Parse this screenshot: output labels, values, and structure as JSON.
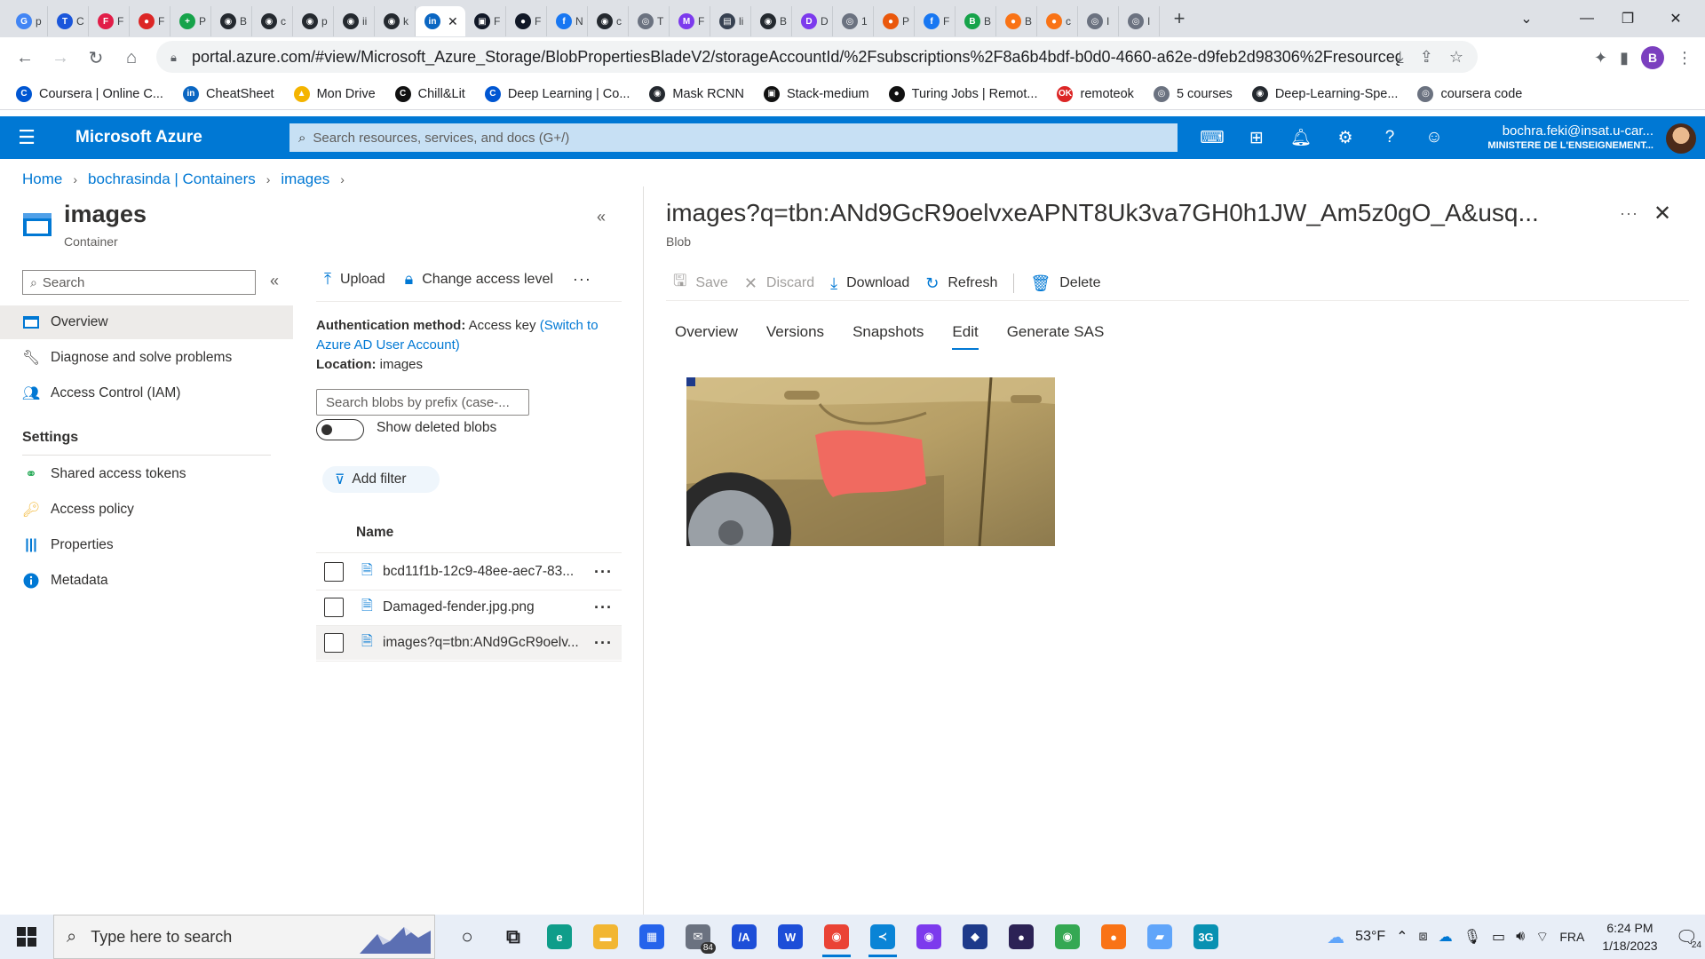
{
  "browser": {
    "tabs": [
      {
        "letter": "G",
        "label": "p",
        "color": "#4285f4"
      },
      {
        "letter": "T",
        "label": "C",
        "color": "#1a56db"
      },
      {
        "letter": "F",
        "label": "F",
        "color": "#e11d48"
      },
      {
        "letter": "●",
        "label": "F",
        "color": "#dc2626"
      },
      {
        "letter": "+",
        "label": "P",
        "color": "#16a34a"
      },
      {
        "letter": "◉",
        "label": "B",
        "color": "#24292f"
      },
      {
        "letter": "◉",
        "label": "c",
        "color": "#24292f"
      },
      {
        "letter": "◉",
        "label": "p",
        "color": "#24292f"
      },
      {
        "letter": "◉",
        "label": "ii",
        "color": "#24292f"
      },
      {
        "letter": "◉",
        "label": "k",
        "color": "#24292f"
      },
      {
        "letter": "in",
        "label": "",
        "color": "#0a66c2"
      },
      {
        "letter": "▣",
        "label": "F",
        "color": "#111827"
      },
      {
        "letter": "●",
        "label": "F",
        "color": "#111827"
      },
      {
        "letter": "f",
        "label": "N",
        "color": "#1877f2"
      },
      {
        "letter": "◉",
        "label": "c",
        "color": "#24292f"
      },
      {
        "letter": "◎",
        "label": "T",
        "color": "#6b7280"
      },
      {
        "letter": "M",
        "label": "F",
        "color": "#7c3aed"
      },
      {
        "letter": "▤",
        "label": "li",
        "color": "#374151"
      },
      {
        "letter": "◉",
        "label": "B",
        "color": "#24292f"
      },
      {
        "letter": "D",
        "label": "D",
        "color": "#7c3aed"
      },
      {
        "letter": "◎",
        "label": "1",
        "color": "#6b7280"
      },
      {
        "letter": "●",
        "label": "P",
        "color": "#ea580c"
      },
      {
        "letter": "f",
        "label": "F",
        "color": "#1877f2"
      },
      {
        "letter": "B",
        "label": "B",
        "color": "#16a34a"
      },
      {
        "letter": "●",
        "label": "B",
        "color": "#f97316"
      },
      {
        "letter": "●",
        "label": "c",
        "color": "#f97316"
      },
      {
        "letter": "◎",
        "label": "I",
        "color": "#6b7280"
      },
      {
        "letter": "◎",
        "label": "I",
        "color": "#6b7280"
      }
    ],
    "active_tab_index": 10,
    "url": "portal.azure.com/#view/Microsoft_Azure_Storage/BlobPropertiesBladeV2/storageAccountId/%2Fsubscriptions%2F8a6b4bdf-b0d0-4660-a62e-d9feb2d98306%2Fresourcegroups%2...",
    "profile_initial": "B",
    "bookmarks": [
      {
        "label": "Coursera | Online C...",
        "icon": "coursera-icon",
        "color": "#0056d2",
        "glyph": "C"
      },
      {
        "label": "CheatSheet",
        "icon": "linkedin-icon",
        "color": "#0a66c2",
        "glyph": "in"
      },
      {
        "label": "Mon Drive",
        "icon": "drive-icon",
        "color": "#f4b400",
        "glyph": "▲"
      },
      {
        "label": "Chill&Lit",
        "icon": "cgl-icon",
        "color": "#111111",
        "glyph": "C"
      },
      {
        "label": "Deep Learning | Co...",
        "icon": "coursera-icon",
        "color": "#0056d2",
        "glyph": "C"
      },
      {
        "label": "Mask RCNN",
        "icon": "github-icon",
        "color": "#24292f",
        "glyph": "◉"
      },
      {
        "label": "Stack-medium",
        "icon": "medium-icon",
        "color": "#111111",
        "glyph": "▣"
      },
      {
        "label": "Turing Jobs | Remot...",
        "icon": "turing-icon",
        "color": "#111111",
        "glyph": "●"
      },
      {
        "label": "remoteok",
        "icon": "remoteok-icon",
        "color": "#dc2626",
        "glyph": "OK"
      },
      {
        "label": "5 courses",
        "icon": "globe-icon",
        "color": "#6b7280",
        "glyph": "◎"
      },
      {
        "label": "Deep-Learning-Spe...",
        "icon": "github-icon",
        "color": "#24292f",
        "glyph": "◉"
      },
      {
        "label": "coursera code",
        "icon": "globe-icon",
        "color": "#6b7280",
        "glyph": "◎"
      }
    ]
  },
  "azure": {
    "brand": "Microsoft Azure",
    "search_placeholder": "Search resources, services, and docs (G+/)",
    "user_email": "bochra.feki@insat.u-car...",
    "user_org": "MINISTERE DE L'ENSEIGNEMENT...",
    "breadcrumb": [
      "Home",
      "bochrasinda | Containers",
      "images"
    ]
  },
  "left": {
    "title": "images",
    "subtitle": "Container",
    "search_placeholder": "Search",
    "nav": [
      {
        "label": "Overview",
        "icon": "overview-icon"
      },
      {
        "label": "Diagnose and solve problems",
        "icon": "wrench-icon"
      },
      {
        "label": "Access Control (IAM)",
        "icon": "people-icon"
      }
    ],
    "settings_heading": "Settings",
    "settings": [
      {
        "label": "Shared access tokens",
        "icon": "link-icon"
      },
      {
        "label": "Access policy",
        "icon": "key-icon"
      },
      {
        "label": "Properties",
        "icon": "properties-icon"
      },
      {
        "label": "Metadata",
        "icon": "info-icon"
      }
    ]
  },
  "middle": {
    "upload_label": "Upload",
    "change_access_label": "Change access level",
    "auth_label": "Authentication method:",
    "auth_value": "Access key",
    "auth_link": "(Switch to Azure AD User Account)",
    "location_label": "Location:",
    "location_value": "images",
    "prefix_placeholder": "Search blobs by prefix (case-...",
    "show_deleted_label": "Show deleted blobs",
    "show_deleted_on": false,
    "add_filter_label": "Add filter",
    "column_name": "Name",
    "blobs": [
      "bcd11f1b-12c9-48ee-aec7-83...",
      "Damaged-fender.jpg.png",
      "images?q=tbn:ANd9GcR9oelv..."
    ]
  },
  "right": {
    "title": "images?q=tbn:ANd9GcR9oelvxeAPNT8Uk3va7GH0h1JW_Am5z0gO_A&usq...",
    "subtitle": "Blob",
    "toolbar": {
      "save": "Save",
      "discard": "Discard",
      "download": "Download",
      "refresh": "Refresh",
      "delete": "Delete"
    },
    "tabs": [
      "Overview",
      "Versions",
      "Snapshots",
      "Edit",
      "Generate SAS"
    ],
    "active_tab": "Edit"
  },
  "taskbar": {
    "search_placeholder": "Type here to search",
    "mail_badge": "84",
    "weather": "53°F",
    "lang": "FRA",
    "time": "6:24 PM",
    "date": "1/18/2023",
    "notif_count": "24",
    "apps": [
      {
        "icon": "cortana-icon",
        "glyph": "○",
        "color": "#202124"
      },
      {
        "icon": "taskview-icon",
        "glyph": "⧉",
        "color": "#202124"
      },
      {
        "icon": "edge-icon",
        "glyph": "e",
        "color": "#0f9d8a"
      },
      {
        "icon": "file-explorer-icon",
        "glyph": "▬",
        "color": "#f2b632"
      },
      {
        "icon": "store-icon",
        "glyph": "▦",
        "color": "#2563eb"
      },
      {
        "icon": "mail-icon",
        "glyph": "✉",
        "color": "#6b7280"
      },
      {
        "icon": "app-icon",
        "glyph": "/A",
        "color": "#1d4ed8"
      },
      {
        "icon": "word-icon",
        "glyph": "W",
        "color": "#1d4ed8"
      },
      {
        "icon": "chrome-icon",
        "glyph": "◉",
        "color": "#ea4335"
      },
      {
        "icon": "vscode-icon",
        "glyph": "≺",
        "color": "#0a84d6"
      },
      {
        "icon": "github-desktop-icon",
        "glyph": "◉",
        "color": "#7c3aed"
      },
      {
        "icon": "virtualbox-icon",
        "glyph": "◆",
        "color": "#1e3a8a"
      },
      {
        "icon": "eclipse-icon",
        "glyph": "●",
        "color": "#2c2255"
      },
      {
        "icon": "chrome-icon",
        "glyph": "◉",
        "color": "#34a853"
      },
      {
        "icon": "postman-icon",
        "glyph": "●",
        "color": "#f97316"
      },
      {
        "icon": "notepad-icon",
        "glyph": "▰",
        "color": "#60a5fa"
      },
      {
        "icon": "3g-icon",
        "glyph": "3G",
        "color": "#0891b2"
      }
    ]
  }
}
